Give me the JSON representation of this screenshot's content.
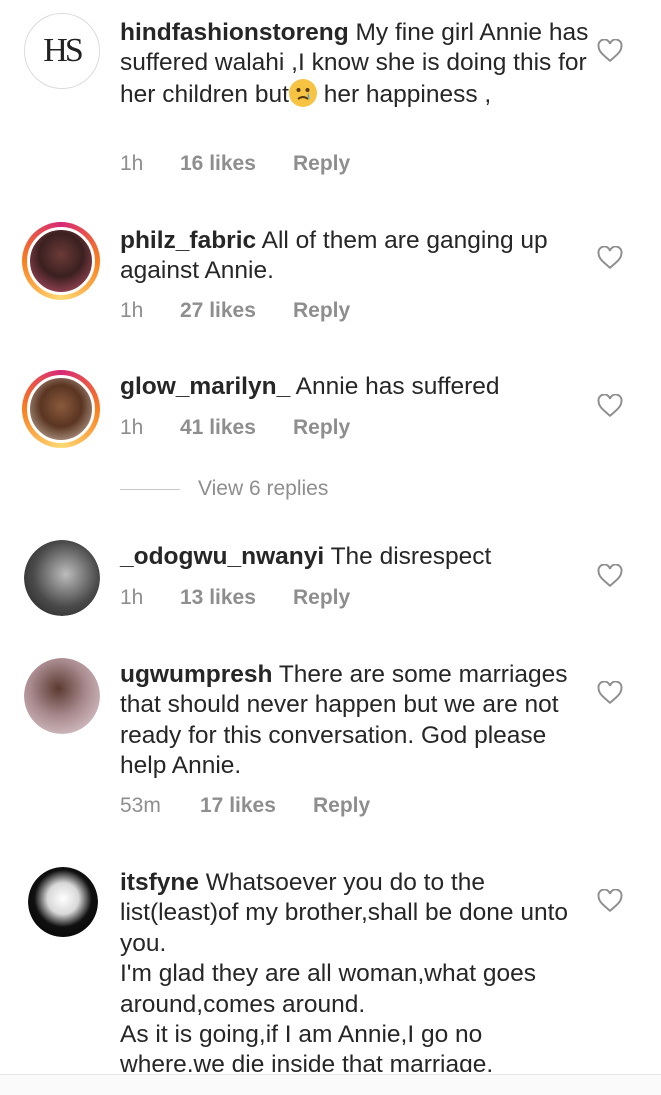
{
  "comments": [
    {
      "username": "hindfashionstoreng",
      "text": "My fine girl Annie has suffered walahi ,I know she is doing this for her children but",
      "emoji": "crying-emoji",
      "text_after": " her happiness ,",
      "time": "1h",
      "likes": "16 likes",
      "reply": "Reply"
    },
    {
      "username": "philz_fabric",
      "text": "All of them are ganging up against Annie.",
      "time": "1h",
      "likes": "27 likes",
      "reply": "Reply"
    },
    {
      "username": "glow_marilyn_",
      "text": "Annie has suffered",
      "time": "1h",
      "likes": "41 likes",
      "reply": "Reply"
    },
    {
      "username": "_odogwu_nwanyi",
      "text": "The disrespect",
      "time": "1h",
      "likes": "13 likes",
      "reply": "Reply"
    },
    {
      "username": "ugwumpresh",
      "text": "There are some marriages that should never happen but we are not ready for this conversation. God please help Annie.",
      "time": "53m",
      "likes": "17 likes",
      "reply": "Reply"
    },
    {
      "username": "itsfyne",
      "text": "Whatsoever you do to the list(least)of my brother,shall be done unto you.\nI'm glad they are all woman,what goes around,comes around.\nAs it is going,if I am Annie,I go no where,we die inside that marriage."
    }
  ],
  "view_replies": "View 6 replies",
  "logo_text": "HS",
  "colors": {
    "meta": "#8e8e8e",
    "text": "#262626",
    "ring_start": "#d62976",
    "ring_end": "#feda75"
  },
  "icons": {
    "like": "heart-outline-icon"
  }
}
